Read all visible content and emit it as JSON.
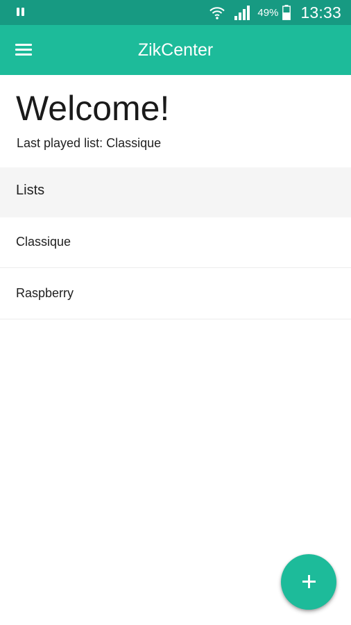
{
  "status_bar": {
    "battery_text": "49%",
    "clock": "13:33",
    "icons": [
      "pause-icon",
      "wifi-icon",
      "signal-icon",
      "battery-icon"
    ]
  },
  "app_bar": {
    "title": "ZikCenter",
    "menu_icon": "hamburger-menu-icon",
    "background_color": "#1dbb9a"
  },
  "welcome": {
    "title": "Welcome!",
    "last_played": "Last played list: Classique"
  },
  "lists": {
    "header": "Lists",
    "items": [
      {
        "label": "Classique"
      },
      {
        "label": "Raspberry"
      }
    ]
  },
  "fab": {
    "icon": "plus-icon",
    "color": "#1dbb9a"
  }
}
